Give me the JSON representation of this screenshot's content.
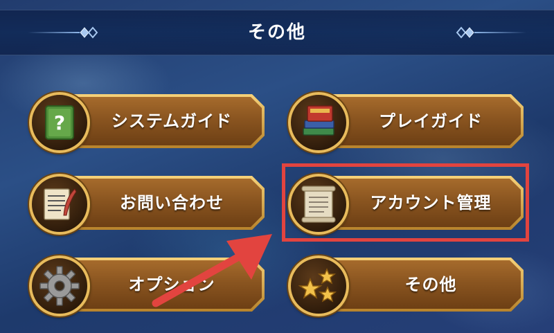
{
  "header": {
    "title": "その他"
  },
  "menu": {
    "system_guide": {
      "label": "システムガイド",
      "icon": "question-book-icon"
    },
    "play_guide": {
      "label": "プレイガイド",
      "icon": "books-stack-icon"
    },
    "contact": {
      "label": "お問い合わせ",
      "icon": "letter-quill-icon"
    },
    "account": {
      "label": "アカウント管理",
      "icon": "scroll-icon"
    },
    "option": {
      "label": "オプション",
      "icon": "gear-icon"
    },
    "other": {
      "label": "その他",
      "icon": "stars-icon"
    }
  },
  "annotation": {
    "highlight_color": "#e2443f",
    "target": "account"
  },
  "colors": {
    "button_brown": "#8a5520",
    "button_gold_rim": "#e8bb5c",
    "title_bar": "#0f2855"
  }
}
